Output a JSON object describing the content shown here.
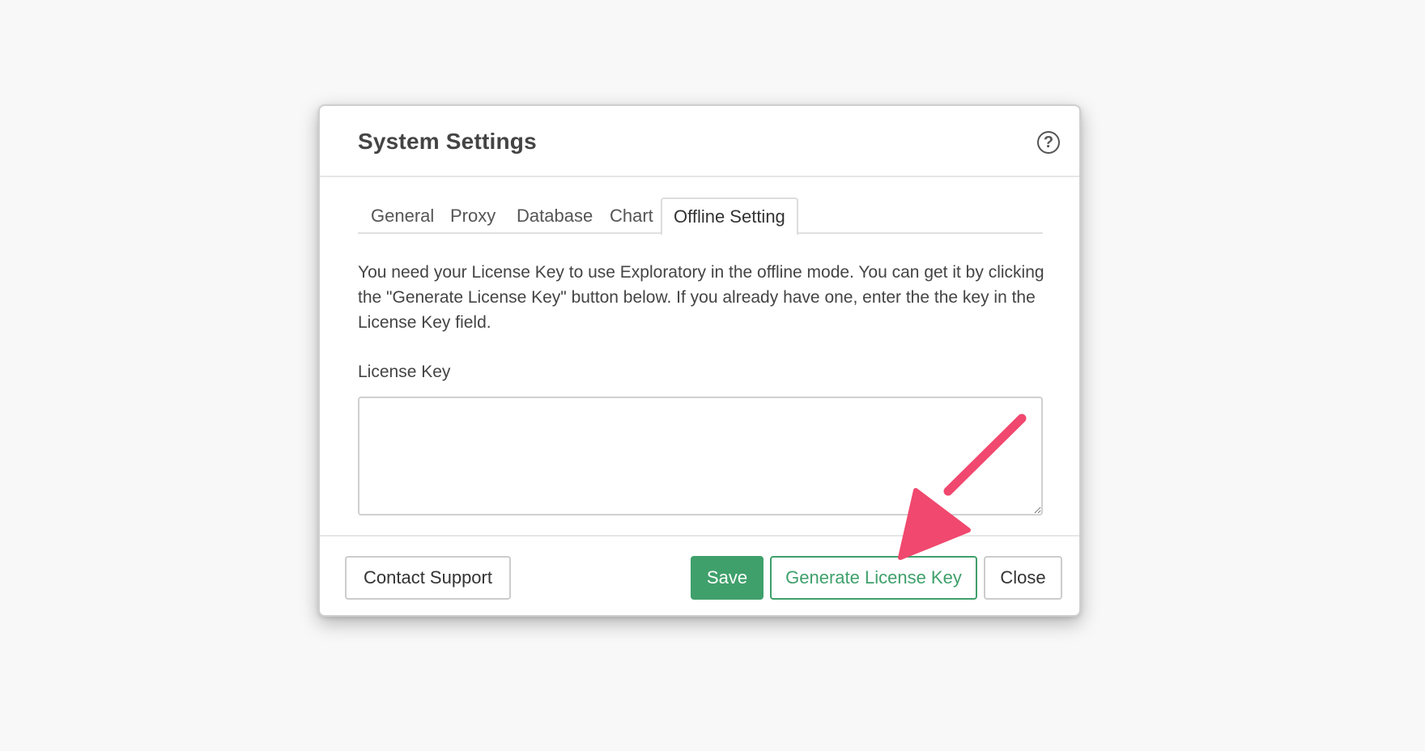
{
  "dialog": {
    "title": "System Settings",
    "help_icon": "question-circle-icon"
  },
  "tabs": [
    {
      "label": "General",
      "active": false
    },
    {
      "label": "Proxy",
      "active": false
    },
    {
      "label": "Database",
      "active": false
    },
    {
      "label": "Chart",
      "active": false
    },
    {
      "label": "Offline Setting",
      "active": true
    }
  ],
  "offline": {
    "description": "You need your License Key to use Exploratory in the offline mode. You can get it by clicking the \"Generate License Key\" button below. If you already have one, enter the the key in the License Key field.",
    "license_label": "License Key",
    "license_value": ""
  },
  "footer": {
    "contact_support_label": "Contact Support",
    "save_label": "Save",
    "generate_label": "Generate License Key",
    "close_label": "Close"
  },
  "colors": {
    "accent_green": "#3fa06b",
    "annotation_arrow": "#f0486e"
  }
}
